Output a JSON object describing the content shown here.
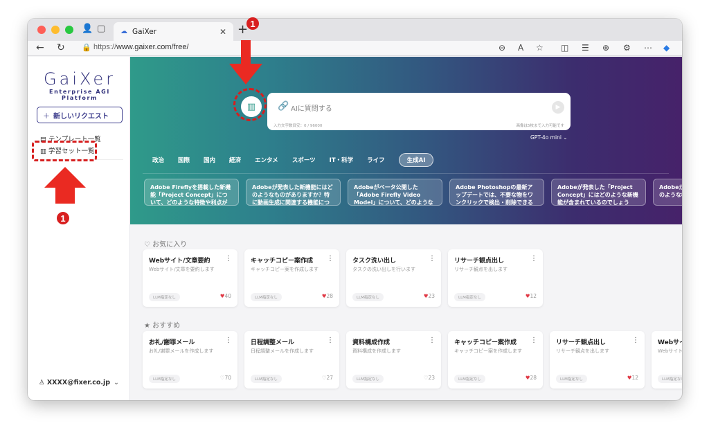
{
  "browser": {
    "tab_title": "GaiXer",
    "url_prefix": "https://",
    "url_host": "www.gaixer.com/free/",
    "new_tab_symbol": "+"
  },
  "sidebar": {
    "logo_word": "GaiXer",
    "logo_sub": "Enterprise AGI Platform",
    "new_request": "新しいリクエスト",
    "items": [
      {
        "label": "テンプレート一覧"
      },
      {
        "label": "学習セット一覧"
      }
    ],
    "user_email": "XXXX@fixer.co.jp"
  },
  "hero": {
    "ask_placeholder": "AIに質問する",
    "char_count": "入力文字数目安：0 / 96000",
    "image_note": "画像は5枚まで入力可能です",
    "model": "GPT-4o mini",
    "categories": [
      "政治",
      "国際",
      "国内",
      "経済",
      "エンタメ",
      "スポーツ",
      "IT・科学",
      "ライフ",
      "生成AI"
    ],
    "active_category": "生成AI",
    "news": [
      "Adobe Fireflyを搭載した新機能「Project Concept」について、どのような特徴や利点があるの…",
      "Adobeが発表した新機能にはどのようなものがありますか？特に動画生成に関連する機能について…",
      "Adobeがベータ公開した「Adobe Firefly Video Model」について、どのような特徴や機能がありま…",
      "Adobe Photoshopの最新アップデートでは、不要な物をワンクリックで検出・削除できる新機能…",
      "Adobeが発表した「Project Concept」にはどのような新機能が含まれているのでしょうか？",
      "Adobeが発表したFireflyはどのような機能"
    ]
  },
  "favorites": {
    "title": "お気に入り",
    "cards": [
      {
        "title": "Webサイト/文章要約",
        "desc": "Webサイト/文章を要約します",
        "tag": "LLM指定なし",
        "likes": "40",
        "liked": true
      },
      {
        "title": "キャッチコピー案作成",
        "desc": "キャッチコピー案を作成します",
        "tag": "LLM指定なし",
        "likes": "28",
        "liked": true
      },
      {
        "title": "タスク洗い出し",
        "desc": "タスクの洗い出しを行います",
        "tag": "LLM指定なし",
        "likes": "23",
        "liked": true
      },
      {
        "title": "リサーチ観点出し",
        "desc": "リサーチ観点を出します",
        "tag": "LLM指定なし",
        "likes": "12",
        "liked": true
      }
    ]
  },
  "recommended": {
    "title": "おすすめ",
    "cards": [
      {
        "title": "お礼/謝罪メール",
        "desc": "お礼/謝罪メールを作成します",
        "tag": "LLM指定なし",
        "likes": "70",
        "liked": false
      },
      {
        "title": "日程調整メール",
        "desc": "日程調整メールを作成します",
        "tag": "LLM指定なし",
        "likes": "27",
        "liked": false
      },
      {
        "title": "資料構成作成",
        "desc": "資料構成を作成します",
        "tag": "LLM指定なし",
        "likes": "23",
        "liked": false
      },
      {
        "title": "キャッチコピー案作成",
        "desc": "キャッチコピー案を作成します",
        "tag": "LLM指定なし",
        "likes": "28",
        "liked": true
      },
      {
        "title": "リサーチ観点出し",
        "desc": "リサーチ観点を出します",
        "tag": "LLM指定なし",
        "likes": "12",
        "liked": true
      },
      {
        "title": "Webサイト/文章要約",
        "desc": "Webサイト/文章を要約します",
        "tag": "LLM指定なし",
        "likes": "",
        "liked": false
      }
    ]
  },
  "annotations": {
    "top_badge": "1",
    "left_badge": "1"
  },
  "colors": {
    "accent": "#3c3c8c",
    "annotation": "#d81f1f",
    "like": "#e03a46"
  }
}
